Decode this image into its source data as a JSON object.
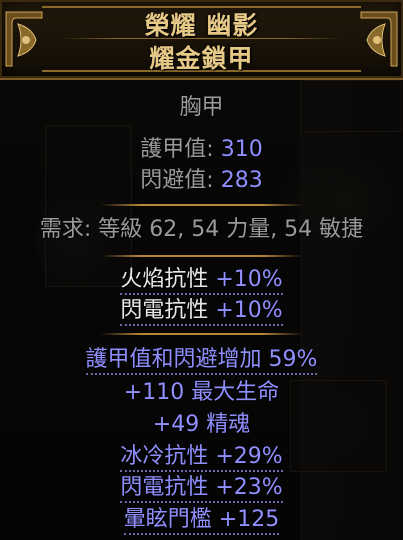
{
  "item": {
    "name": "榮耀 幽影",
    "base_type": "耀金鎖甲",
    "item_class": "胸甲",
    "properties": [
      {
        "label": "護甲值:",
        "value": "310"
      },
      {
        "label": "閃避值:",
        "value": "283"
      }
    ],
    "requirements": "需求: 等級 62, 54 力量, 54 敏捷",
    "implicit_mods": [
      {
        "name": "火焰抗性",
        "value": "+10%"
      },
      {
        "name": "閃電抗性",
        "value": "+10%"
      }
    ],
    "explicit_mods": [
      {
        "name": "護甲值和閃避增加",
        "value": "59%"
      },
      {
        "value": "+110",
        "name": "最大生命"
      },
      {
        "value": "+49",
        "name": "精魂"
      },
      {
        "name": "冰冷抗性",
        "value": "+29%"
      },
      {
        "name": "閃電抗性",
        "value": "+23%"
      },
      {
        "name": "暈眩門檻",
        "value": "+125"
      }
    ]
  },
  "colors": {
    "title": "#e6c887",
    "label": "#9a9a9a",
    "value": "#8f8fff",
    "mod": "#8f8fff",
    "separator": "#b8863a"
  },
  "icons": [
    "ornate-corner-left-icon",
    "ornate-corner-right-icon"
  ]
}
